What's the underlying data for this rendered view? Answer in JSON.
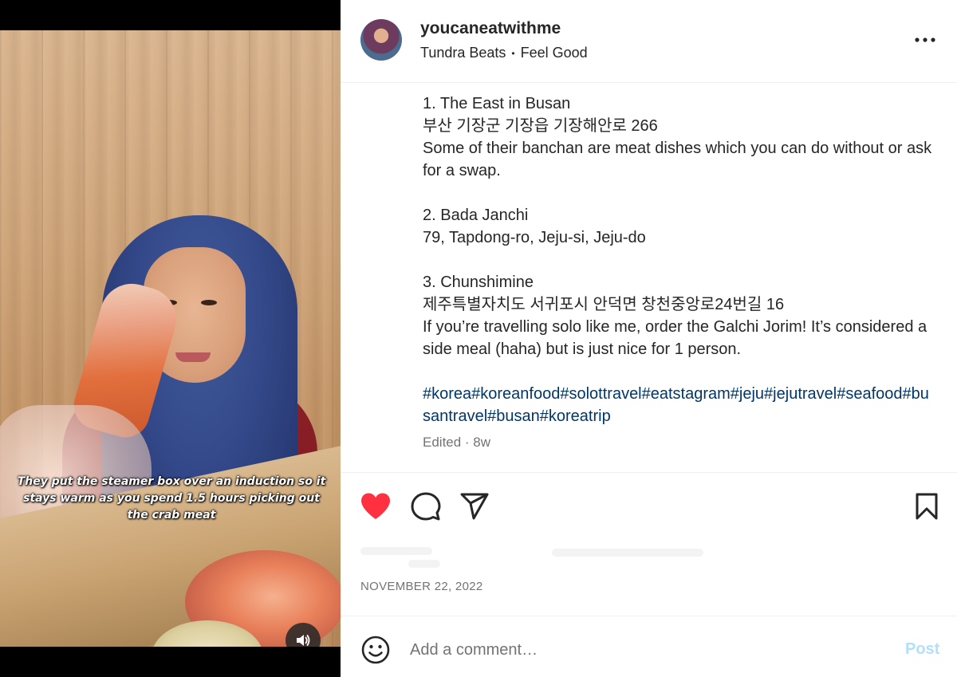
{
  "media": {
    "caption": "They put the steamer box over an induction so it stays warm as you spend 1.5 hours picking out the crab meat",
    "sound_icon": "speaker-icon"
  },
  "header": {
    "username": "youcaneatwithme",
    "audio_artist": "Tundra Beats",
    "audio_separator": "•",
    "audio_track": "Feel Good",
    "more_icon": "more-horizontal-icon"
  },
  "post": {
    "lines": [
      "1. The East in Busan",
      "부산 기장군 기장읍 기장해안로 266",
      "Some of their banchan are meat dishes which you can do without or ask for a swap.",
      "",
      "2. Bada Janchi",
      "79, Tapdong-ro, Jeju-si, Jeju-do",
      "",
      "3. Chunshimine",
      "제주특별자치도 서귀포시 안덕면 창천중앙로24번길 16",
      "If you’re travelling solo like me, order the Galchi Jorim! It’s considered a side meal (haha) but is just nice for 1 person.",
      ""
    ],
    "hashtags": "#korea#koreanfood#solottravel#eatstagram#jeju#jejutravel#seafood#busantravel#busan#koreatrip",
    "edited": "Edited · 8w"
  },
  "actions": {
    "like_icon": "heart-filled-icon",
    "comment_icon": "comment-icon",
    "share_icon": "share-icon",
    "save_icon": "bookmark-icon",
    "like_color": "#ff3040"
  },
  "date": "NOVEMBER 22, 2022",
  "comment": {
    "placeholder": "Add a comment…",
    "post_label": "Post",
    "post_color": "#b2dffc"
  }
}
